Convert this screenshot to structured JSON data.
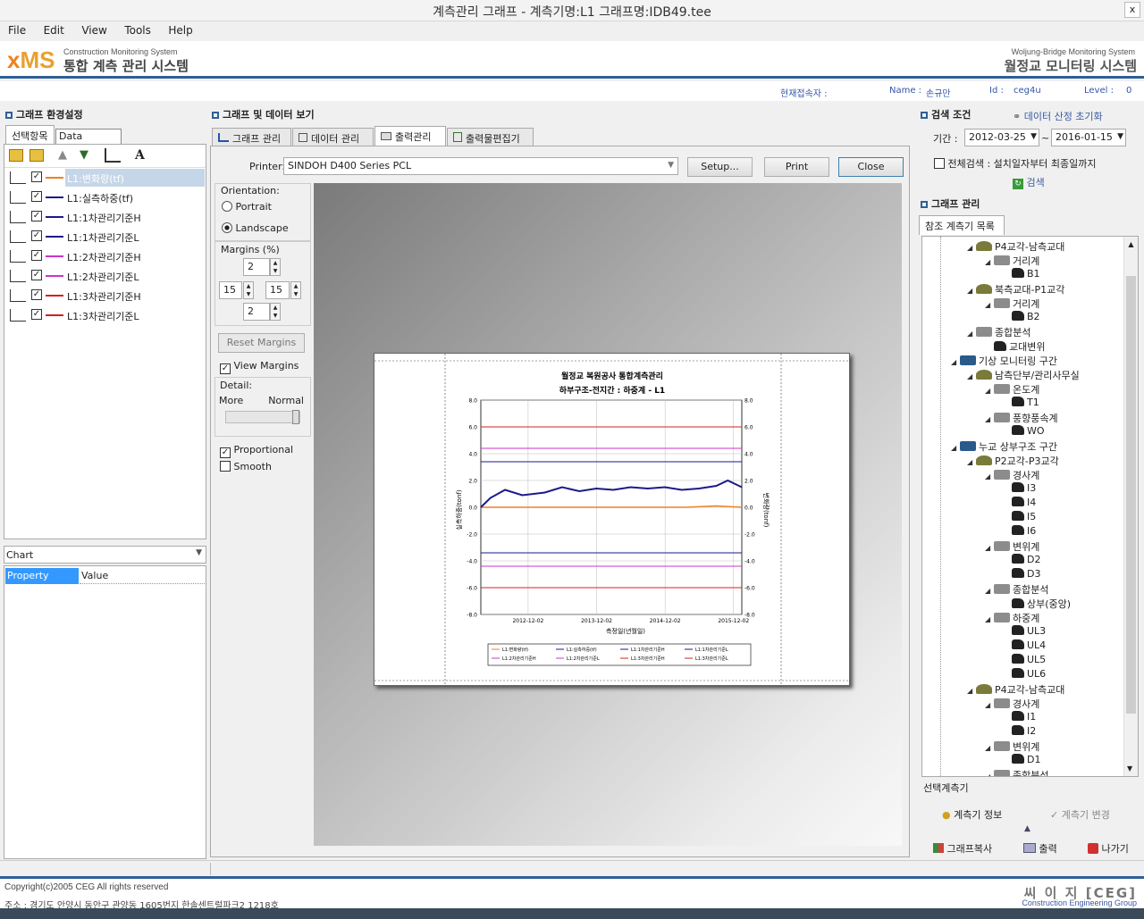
{
  "window": {
    "title": "계측관리 그래프 - 계측기명:L1 그래프명:IDB49.tee",
    "close": "x"
  },
  "menu": [
    "File",
    "Edit",
    "View",
    "Tools",
    "Help"
  ],
  "brand": {
    "x": "x",
    "ms": "MS",
    "sub": "Construction  Monitoring System",
    "main": "통합 계측 관리 시스템",
    "right_sub": "Woljung-Bridge  Monitoring System",
    "right_main": "월정교 모니터링 시스템"
  },
  "user": {
    "current_label": "현재접속자 :",
    "name_label": "Name :",
    "name": "손규만",
    "id_label": "Id :",
    "id": "ceg4u",
    "level_label": "Level :",
    "level": "0"
  },
  "left": {
    "section": "그래프 환경설정",
    "tabs": [
      "선택항목",
      "Data Connect"
    ],
    "series": [
      {
        "label": "L1:변화량(tf)",
        "color": "#f08020",
        "selected": true
      },
      {
        "label": "L1:실측하중(tf)",
        "color": "#1a1a8c",
        "selected": false
      },
      {
        "label": "L1:1차관리기준H",
        "color": "#1a1a8c",
        "selected": false
      },
      {
        "label": "L1:1차관리기준L",
        "color": "#1a1a8c",
        "selected": false
      },
      {
        "label": "L1:2차관리기준H",
        "color": "#cc33cc",
        "selected": false
      },
      {
        "label": "L1:2차관리기준L",
        "color": "#cc33cc",
        "selected": false
      },
      {
        "label": "L1:3차관리기준H",
        "color": "#d42020",
        "selected": false
      },
      {
        "label": "L1:3차관리기준L",
        "color": "#d42020",
        "selected": false
      }
    ],
    "chart_select": "Chart",
    "prop_header": "Property",
    "value_header": "Value"
  },
  "middle": {
    "section": "그래프 및 데이터 보기",
    "tabs": [
      "그래프 관리",
      "데이터 관리",
      "출력관리",
      "출력물편집기"
    ],
    "printer_label": "Printer:",
    "printer_value": "SINDOH D400 Series PCL",
    "setup": "Setup...",
    "print": "Print",
    "close": "Close",
    "orientation_label": "Orientation:",
    "portrait": "Portrait",
    "landscape": "Landscape",
    "margins_label": "Margins (%)",
    "margin_top": "2",
    "margin_left": "15",
    "margin_right": "15",
    "margin_bottom": "2",
    "reset_margins": "Reset Margins",
    "view_margins": "View Margins",
    "detail_label": "Detail:",
    "more": "More",
    "normal": "Normal",
    "proportional": "Proportional",
    "smooth": "Smooth"
  },
  "chart_data": {
    "type": "line",
    "title": "월정교 복원공사 통합계측관리",
    "subtitle": "하부구조-전지간 : 하중계 - L1",
    "xlabel": "측정일(년월일)",
    "ylabel": "실측하중(tonf)",
    "y2label": "변화량(tonf)",
    "ylim": [
      -8.0,
      8.0
    ],
    "yticks": [
      "8.0",
      "6.0",
      "4.0",
      "2.0",
      "0.0",
      "-2.0",
      "-4.0",
      "-6.0",
      "-8.0"
    ],
    "xticks": [
      "2012-12-02",
      "2013-12-02",
      "2014-12-02",
      "2015-12-02"
    ],
    "x_range": [
      "2012-03-25",
      "2016-01-15"
    ],
    "series": [
      {
        "name": "L1:변화량(tf)",
        "color": "#f08020",
        "x": [
          "2012-03-25",
          "2013-03-25",
          "2014-03-25",
          "2015-03-25",
          "2015-09-01",
          "2016-01-15"
        ],
        "values": [
          0.0,
          0.0,
          0.0,
          0.0,
          0.1,
          0.0
        ]
      },
      {
        "name": "L1:실측하중(tf)",
        "color": "#1a1a8c",
        "x": [
          "2012-03-25",
          "2012-05-15",
          "2012-08-01",
          "2012-11-01",
          "2013-03-01",
          "2013-06-01",
          "2013-09-01",
          "2013-12-01",
          "2014-03-01",
          "2014-06-01",
          "2014-09-01",
          "2014-12-01",
          "2015-03-01",
          "2015-06-01",
          "2015-09-01",
          "2015-11-01",
          "2016-01-15"
        ],
        "values": [
          0.0,
          0.7,
          1.3,
          0.9,
          1.1,
          1.5,
          1.2,
          1.4,
          1.3,
          1.5,
          1.4,
          1.5,
          1.3,
          1.4,
          1.6,
          2.0,
          1.5
        ]
      },
      {
        "name": "L1:1차관리기준H",
        "color": "#1a1a8c",
        "constant": 3.4
      },
      {
        "name": "L1:1차관리기준L",
        "color": "#1a1a8c",
        "constant": -3.4
      },
      {
        "name": "L1:2차관리기준H",
        "color": "#cc33cc",
        "constant": 4.4
      },
      {
        "name": "L1:2차관리기준L",
        "color": "#cc33cc",
        "constant": -4.4
      },
      {
        "name": "L1:3차관리기준H",
        "color": "#d42020",
        "constant": 6.0
      },
      {
        "name": "L1:3차관리기준L",
        "color": "#d42020",
        "constant": -6.0
      }
    ],
    "grid": true,
    "legend": "bottom"
  },
  "right": {
    "section": "검색 조건",
    "reset": "데이터 산정 초기화",
    "period_label": "기간 :",
    "date_from": "2012-03-25",
    "tilde": "~",
    "date_to": "2016-01-15",
    "all_search": "전체검색 : 설치일자부터 최종일까지",
    "search": "검색",
    "graph_section": "그래프 관리",
    "ref_tab": "참조 계측기 목록",
    "tree": [
      {
        "label": "P4교각-남측교대",
        "level": 2,
        "icon": "g",
        "arrow": "◢"
      },
      {
        "label": "거리계",
        "level": 3,
        "icon": "p",
        "arrow": "◢"
      },
      {
        "label": "B1",
        "level": 4,
        "icon": "s",
        "arrow": ""
      },
      {
        "label": "북측교대-P1교각",
        "level": 2,
        "icon": "g",
        "arrow": "◢"
      },
      {
        "label": "거리계",
        "level": 3,
        "icon": "p",
        "arrow": "◢"
      },
      {
        "label": "B2",
        "level": 4,
        "icon": "s",
        "arrow": ""
      },
      {
        "label": "종합분석",
        "level": 2,
        "icon": "p",
        "arrow": "◢"
      },
      {
        "label": "교대변위",
        "level": 3,
        "icon": "s",
        "arrow": ""
      },
      {
        "label": "기상 모니터링 구간",
        "level": 1,
        "icon": "c",
        "arrow": "◢"
      },
      {
        "label": "남측단부/관리사무실",
        "level": 2,
        "icon": "g",
        "arrow": "◢"
      },
      {
        "label": "온도계",
        "level": 3,
        "icon": "p",
        "arrow": "◢"
      },
      {
        "label": "T1",
        "level": 4,
        "icon": "s",
        "arrow": ""
      },
      {
        "label": "풍향풍속계",
        "level": 3,
        "icon": "p",
        "arrow": "◢"
      },
      {
        "label": "WO",
        "level": 4,
        "icon": "s",
        "arrow": ""
      },
      {
        "label": "누교 상부구조 구간",
        "level": 1,
        "icon": "c",
        "arrow": "◢"
      },
      {
        "label": "P2교각-P3교각",
        "level": 2,
        "icon": "g",
        "arrow": "◢"
      },
      {
        "label": "경사계",
        "level": 3,
        "icon": "p",
        "arrow": "◢"
      },
      {
        "label": "I3",
        "level": 4,
        "icon": "s",
        "arrow": ""
      },
      {
        "label": "I4",
        "level": 4,
        "icon": "s",
        "arrow": ""
      },
      {
        "label": "I5",
        "level": 4,
        "icon": "s",
        "arrow": ""
      },
      {
        "label": "I6",
        "level": 4,
        "icon": "s",
        "arrow": ""
      },
      {
        "label": "변위계",
        "level": 3,
        "icon": "p",
        "arrow": "◢"
      },
      {
        "label": "D2",
        "level": 4,
        "icon": "s",
        "arrow": ""
      },
      {
        "label": "D3",
        "level": 4,
        "icon": "s",
        "arrow": ""
      },
      {
        "label": "종합분석",
        "level": 3,
        "icon": "p",
        "arrow": "◢"
      },
      {
        "label": "상부(중앙)",
        "level": 4,
        "icon": "s",
        "arrow": ""
      },
      {
        "label": "하중계",
        "level": 3,
        "icon": "p",
        "arrow": "◢"
      },
      {
        "label": "UL3",
        "level": 4,
        "icon": "s",
        "arrow": ""
      },
      {
        "label": "UL4",
        "level": 4,
        "icon": "s",
        "arrow": ""
      },
      {
        "label": "UL5",
        "level": 4,
        "icon": "s",
        "arrow": ""
      },
      {
        "label": "UL6",
        "level": 4,
        "icon": "s",
        "arrow": ""
      },
      {
        "label": "P4교각-남측교대",
        "level": 2,
        "icon": "g",
        "arrow": "◢"
      },
      {
        "label": "경사계",
        "level": 3,
        "icon": "p",
        "arrow": "◢"
      },
      {
        "label": "I1",
        "level": 4,
        "icon": "s",
        "arrow": ""
      },
      {
        "label": "I2",
        "level": 4,
        "icon": "s",
        "arrow": ""
      },
      {
        "label": "변위계",
        "level": 3,
        "icon": "p",
        "arrow": "◢"
      },
      {
        "label": "D1",
        "level": 4,
        "icon": "s",
        "arrow": ""
      },
      {
        "label": "종합분석",
        "level": 3,
        "icon": "p",
        "arrow": "◢"
      }
    ],
    "selected_label": "선택계측기",
    "info_btn": "계측기 정보",
    "change_btn": "계측기 변경",
    "copy_btn": "그래프복사",
    "print_btn": "출력",
    "exit_btn": "나가기"
  },
  "footer": {
    "copyright": "Copyright(c)2005 CEG All rights reserved",
    "address": "주소 : 경기도 안양시 동안구 관양동 1605번지 한솔센트럴파크2 1218호",
    "ceg": "씨 이 지 [CEG]",
    "ceg_sub": "Construction  Engineering Group"
  }
}
